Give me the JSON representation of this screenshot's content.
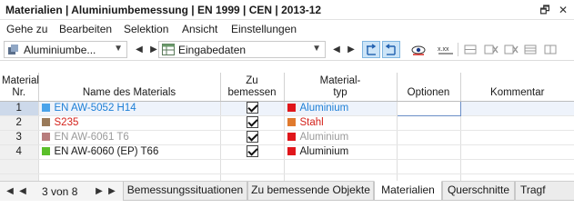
{
  "window": {
    "title": "Materialien | Aluminiumbemessung | EN 1999 | CEN | 2013-12"
  },
  "menu": [
    "Gehe zu",
    "Bearbeiten",
    "Selektion",
    "Ansicht",
    "Einstellungen"
  ],
  "toolbar": {
    "module_select": "Aluminiumbe...",
    "table_select": "Eingabedaten"
  },
  "table": {
    "headers": {
      "nr": "Material\nNr.",
      "name": "Name des Materials",
      "design": "Zu\nbemessen",
      "type": "Material-\ntyp",
      "options": "Optionen",
      "comment": "Kommentar"
    },
    "rows": [
      {
        "nr": "1",
        "name": "EN AW-5052 H14",
        "name_color": "#1e7fd6",
        "swatch": "#4aa3ea",
        "design": true,
        "type": "Aluminium",
        "type_color": "#1e7fd6",
        "type_swatch": "#e0161b",
        "options": "",
        "comment": ""
      },
      {
        "nr": "2",
        "name": "S235",
        "name_color": "#d4231c",
        "swatch": "#9a7a5a",
        "design": true,
        "type": "Stahl",
        "type_color": "#d4231c",
        "type_swatch": "#e07a2e",
        "options": "",
        "comment": ""
      },
      {
        "nr": "3",
        "name": "EN AW-6061 T6",
        "name_color": "#9a9a9a",
        "swatch": "#b87c7c",
        "design": true,
        "type": "Aluminium",
        "type_color": "#9a9a9a",
        "type_swatch": "#e0161b",
        "options": "",
        "comment": ""
      },
      {
        "nr": "4",
        "name": "EN AW-6060 (EP) T66",
        "name_color": "#1a1a1a",
        "swatch": "#5bbf2a",
        "design": true,
        "type": "Aluminium",
        "type_color": "#1a1a1a",
        "type_swatch": "#e0161b",
        "options": "",
        "comment": ""
      }
    ]
  },
  "status": {
    "page": "3 von 8",
    "tabs": [
      "Bemessungssituationen",
      "Zu bemessende Objekte",
      "Materialien",
      "Querschnitte",
      "Tragf"
    ],
    "active_tab": 2
  }
}
